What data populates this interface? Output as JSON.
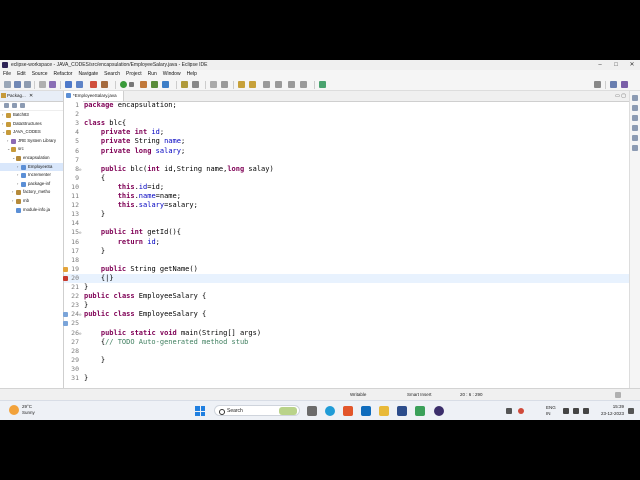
{
  "window": {
    "title": "eclipse-workspace - JAVA_CODES/src/encapsulation/EmployeeSalary.java - Eclipse IDE",
    "controls": [
      "–",
      "□",
      "✕"
    ]
  },
  "menu": [
    "File",
    "Edit",
    "Source",
    "Refactor",
    "Navigate",
    "Search",
    "Project",
    "Run",
    "Window",
    "Help"
  ],
  "explorer": {
    "tab_label": "Packag...",
    "close": "✕",
    "items": [
      {
        "label": "Batch83",
        "indent": 0,
        "arrow": "›",
        "icon": "project-icon",
        "selected": false
      },
      {
        "label": "DataStructures",
        "indent": 0,
        "arrow": "›",
        "icon": "project-icon",
        "selected": false
      },
      {
        "label": "JAVA_CODES",
        "indent": 0,
        "arrow": "⌄",
        "icon": "project-icon",
        "selected": false
      },
      {
        "label": "JRE System Library",
        "indent": 1,
        "arrow": "›",
        "icon": "library-icon",
        "selected": false
      },
      {
        "label": "src",
        "indent": 1,
        "arrow": "⌄",
        "icon": "source-folder-icon",
        "selected": false
      },
      {
        "label": "encapsulation",
        "indent": 2,
        "arrow": "⌄",
        "icon": "package-icon",
        "selected": false
      },
      {
        "label": "EmployeeSa",
        "indent": 3,
        "arrow": "›",
        "icon": "java-file-icon",
        "selected": true
      },
      {
        "label": "Incrementer",
        "indent": 3,
        "arrow": "›",
        "icon": "java-file-icon",
        "selected": false
      },
      {
        "label": "package-inf",
        "indent": 3,
        "arrow": "›",
        "icon": "java-file-icon",
        "selected": false
      },
      {
        "label": "factory_metho",
        "indent": 2,
        "arrow": "›",
        "icon": "package-icon",
        "selected": false
      },
      {
        "label": "mb",
        "indent": 2,
        "arrow": "›",
        "icon": "package-icon",
        "selected": false
      },
      {
        "label": "module-info.ja",
        "indent": 2,
        "arrow": "",
        "icon": "java-file-icon",
        "selected": false
      }
    ]
  },
  "editor": {
    "tab_label": "*EmployeeSalary.java",
    "tab_close": "✕",
    "lines": [
      {
        "n": "1",
        "code": "package encapsulation;"
      },
      {
        "n": "2",
        "code": ""
      },
      {
        "n": "3",
        "code": "class blc{"
      },
      {
        "n": "4",
        "code": "    private int id;"
      },
      {
        "n": "5",
        "code": "    private String name;"
      },
      {
        "n": "6",
        "code": "    private long salary;"
      },
      {
        "n": "7",
        "code": ""
      },
      {
        "n": "8",
        "code": "    public blc(int id,String name,long salay)"
      },
      {
        "n": "9",
        "code": "    {"
      },
      {
        "n": "10",
        "code": "        this.id=id;"
      },
      {
        "n": "11",
        "code": "        this.name=name;"
      },
      {
        "n": "12",
        "code": "        this.salary=salary;"
      },
      {
        "n": "13",
        "code": "    }"
      },
      {
        "n": "14",
        "code": ""
      },
      {
        "n": "15",
        "code": "    public int getId(){"
      },
      {
        "n": "16",
        "code": "        return id;"
      },
      {
        "n": "17",
        "code": "    }"
      },
      {
        "n": "18",
        "code": ""
      },
      {
        "n": "19",
        "code": "    public String getName()"
      },
      {
        "n": "20",
        "code": "    {|}"
      },
      {
        "n": "21",
        "code": "}"
      },
      {
        "n": "22",
        "code": "public class EmployeeSalary {"
      },
      {
        "n": "23",
        "code": "}"
      },
      {
        "n": "24",
        "code": "public class EmployeeSalary {"
      },
      {
        "n": "25",
        "code": ""
      },
      {
        "n": "26",
        "code": "    public static void main(String[] args)"
      },
      {
        "n": "27",
        "code": "    {// TODO Auto-generated method stub"
      },
      {
        "n": "28",
        "code": ""
      },
      {
        "n": "29",
        "code": "    }"
      },
      {
        "n": "30",
        "code": ""
      },
      {
        "n": "31",
        "code": "}"
      }
    ]
  },
  "status": {
    "mode": "Writable",
    "insert": "Smart Insert",
    "position": "20 : 6 : 290"
  },
  "taskbar": {
    "temperature": "29°C",
    "condition": "Sunny",
    "search_label": "Search",
    "lang_top": "ENG",
    "lang_bottom": "IN",
    "time": "15:39",
    "date": "23-12-2023"
  }
}
